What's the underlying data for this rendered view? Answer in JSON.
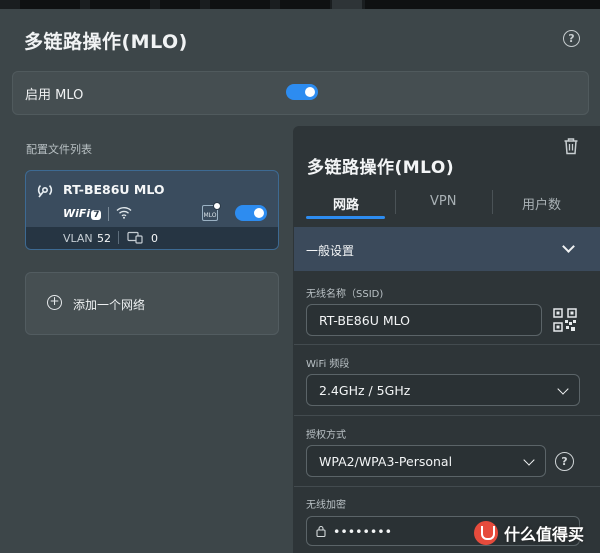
{
  "header": {
    "title": "多链路操作(MLO)",
    "help_icon": "?"
  },
  "mlo_toggle": {
    "label": "启用 MLO",
    "enabled": true
  },
  "profiles": {
    "section_label": "配置文件列表",
    "items": [
      {
        "name": "RT-BE86U MLO",
        "wifi_badge": "WiFi",
        "wifi_gen": "7",
        "chip_label": "MLO",
        "enabled": true,
        "vlan_label": "VLAN",
        "vlan_value": "52",
        "device_count": "0"
      }
    ],
    "add_label": "添加一个网络"
  },
  "panel": {
    "title": "多链路操作(MLO)",
    "tabs": [
      {
        "label": "网路",
        "active": true
      },
      {
        "label": "VPN",
        "active": false
      },
      {
        "label": "用户数",
        "active": false
      }
    ],
    "general": {
      "label": "一般设置"
    },
    "fields": {
      "ssid": {
        "label": "无线名称（SSID)",
        "value": "RT-BE86U MLO"
      },
      "band": {
        "label": "WiFi 频段",
        "value": "2.4GHz / 5GHz"
      },
      "auth": {
        "label": "授权方式",
        "value": "WPA2/WPA3-Personal"
      },
      "encryption": {
        "label": "无线加密",
        "value": "••••••••"
      }
    }
  },
  "watermark": {
    "text": "什么值得买",
    "logo": "值"
  },
  "colors": {
    "accent": "#2d8cf0",
    "panel_bg": "#2e3538",
    "page_bg": "#3d4649",
    "card_selected": "#3a4c5e"
  }
}
